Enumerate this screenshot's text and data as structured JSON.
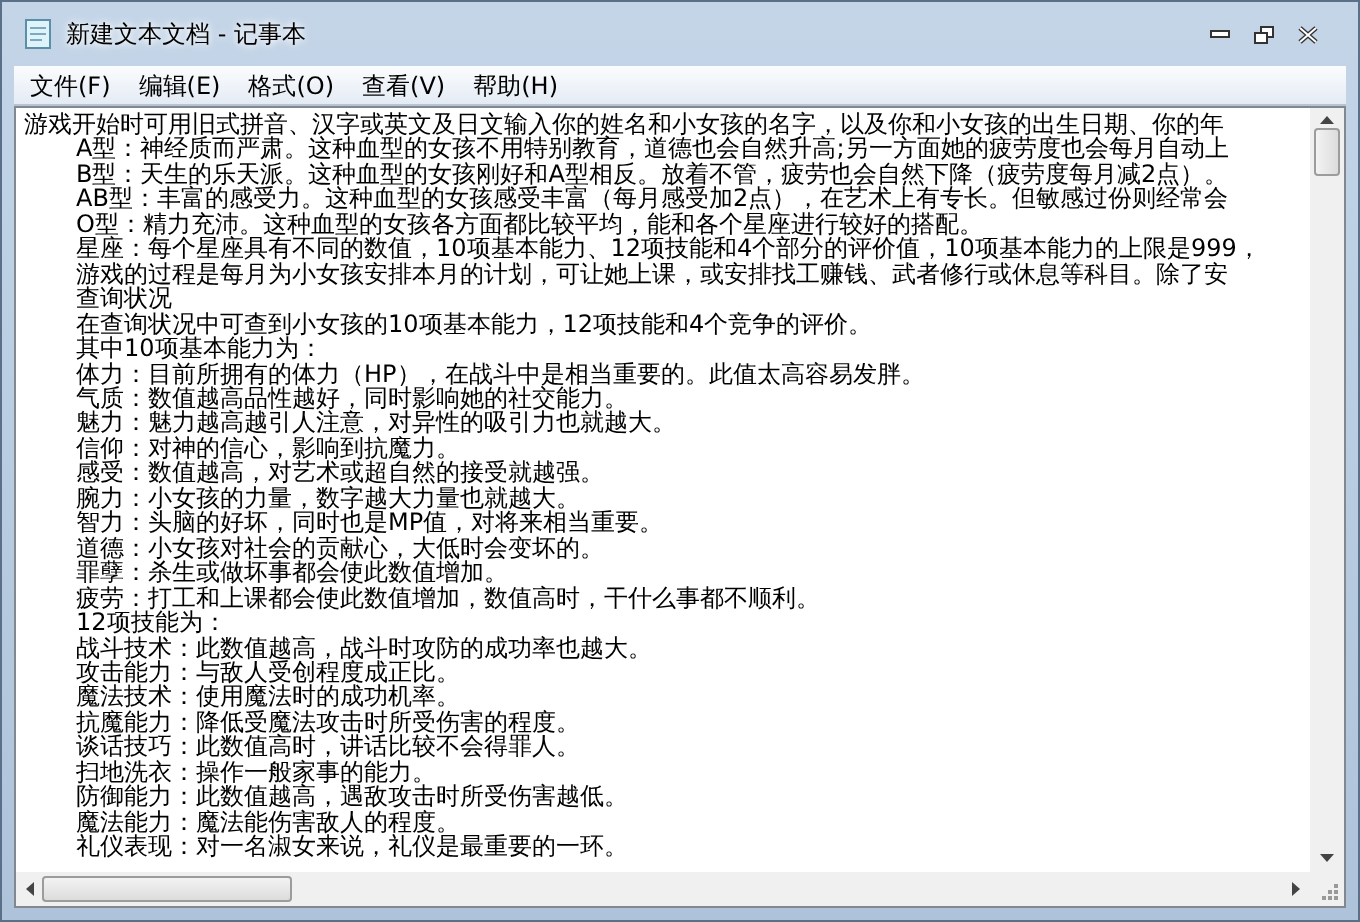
{
  "window": {
    "title": "新建文本文档 - 记事本"
  },
  "menu": [
    {
      "label": "文件(F)"
    },
    {
      "label": "编辑(E)"
    },
    {
      "label": "格式(O)"
    },
    {
      "label": "查看(V)"
    },
    {
      "label": "帮助(H)"
    }
  ],
  "document": {
    "first_line": "游戏开始时可用旧式拼音、汉字或英文及日文输入你的姓名和小女孩的名字，以及你和小女孩的出生日期、你的年",
    "indented_lines": [
      "A型：神经质而严肃。这种血型的女孩不用特别教育，道德也会自然升高;另一方面她的疲劳度也会每月自动上",
      "B型：天生的乐天派。这种血型的女孩刚好和A型相反。放着不管，疲劳也会自然下降（疲劳度每月减2点）。",
      "AB型：丰富的感受力。这种血型的女孩感受丰富（每月感受加2点），在艺术上有专长。但敏感过份则经常会",
      "O型：精力充沛。这种血型的女孩各方面都比较平均，能和各个星座进行较好的搭配。",
      "星座：每个星座具有不同的数值，10项基本能力、12项技能和4个部分的评价值，10项基本能力的上限是999，",
      "游戏的过程是每月为小女孩安排本月的计划，可让她上课，或安排找工赚钱、武者修行或休息等科目。除了安",
      "查询状况",
      "在查询状况中可查到小女孩的10项基本能力，12项技能和4个竞争的评价。",
      "其中10项基本能力为：",
      "体力：目前所拥有的体力（HP），在战斗中是相当重要的。此值太高容易发胖。",
      "气质：数值越高品性越好，同时影响她的社交能力。",
      "魅力：魅力越高越引人注意，对异性的吸引力也就越大。",
      "信仰：对神的信心，影响到抗魔力。",
      "感受：数值越高，对艺术或超自然的接受就越强。",
      "腕力：小女孩的力量，数字越大力量也就越大。",
      "智力：头脑的好坏，同时也是MP值，对将来相当重要。",
      "道德：小女孩对社会的贡献心，大低时会变坏的。",
      "罪孽：杀生或做坏事都会使此数值增加。",
      "疲劳：打工和上课都会使此数值增加，数值高时，干什么事都不顺利。",
      "12项技能为：",
      "战斗技术：此数值越高，战斗时攻防的成功率也越大。",
      "攻击能力：与敌人受创程度成正比。",
      "魔法技术：使用魔法时的成功机率。",
      "抗魔能力：降低受魔法攻击时所受伤害的程度。",
      "谈话技巧：此数值高时，讲话比较不会得罪人。",
      "扫地洗衣：操作一般家事的能力。",
      "防御能力：此数值越高，遇敌攻击时所受伤害越低。",
      "魔法能力：魔法能伤害敌人的程度。",
      "礼仪表现：对一名淑女来说，礼仪是最重要的一环。"
    ]
  }
}
